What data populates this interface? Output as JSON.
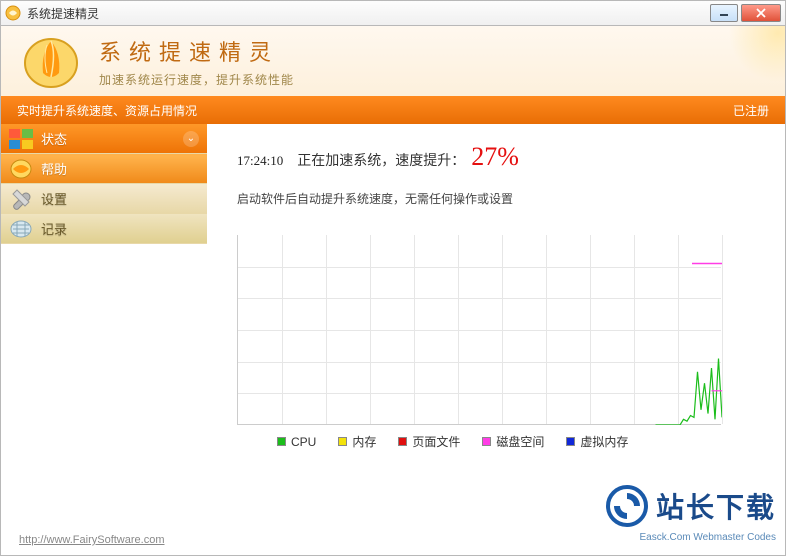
{
  "window": {
    "title": "系统提速精灵"
  },
  "brand": {
    "title": "系统提速精灵",
    "subtitle": "加速系统运行速度，提升系统性能"
  },
  "statusbar": {
    "left": "实时提升系统速度、资源占用情况",
    "right": "已注册"
  },
  "sidebar": {
    "items": [
      {
        "label": "状态",
        "icon": "windows"
      },
      {
        "label": "帮助",
        "icon": "help"
      },
      {
        "label": "设置",
        "icon": "wrench"
      },
      {
        "label": "记录",
        "icon": "log"
      }
    ]
  },
  "main": {
    "time": "17:24:10",
    "msg": "正在加速系统，速度提升：",
    "boost": "27%",
    "sub": "启动软件后自动提升系统速度，无需任何操作或设置"
  },
  "chart_data": {
    "type": "line",
    "xlabel": "",
    "ylabel": "",
    "xlim": [
      0,
      100
    ],
    "ylim": [
      0,
      100
    ],
    "grid_rows": 6,
    "grid_cols": 11,
    "series": [
      {
        "name": "CPU",
        "color": "#1bbd1b",
        "values": [
          0,
          0,
          0,
          0,
          0,
          0,
          0,
          0,
          3,
          2,
          5,
          4,
          28,
          8,
          22,
          6,
          30,
          3,
          35,
          4
        ]
      },
      {
        "name": "内存",
        "color": "#f3e20a",
        "values": []
      },
      {
        "name": "页面文件",
        "color": "#e01010",
        "values": []
      },
      {
        "name": "磁盘空间",
        "color": "#ff3de6",
        "values": [
          18,
          18,
          18,
          18
        ]
      },
      {
        "name": "虚拟内存",
        "color": "#1028d8",
        "values": []
      }
    ],
    "legend_labels": [
      "CPU",
      "内存",
      "页面文件",
      "磁盘空间",
      "虚拟内存"
    ]
  },
  "footer": {
    "url": "http://www.FairySoftware.com"
  },
  "watermark": {
    "text": "站长下载",
    "sub": "Easck.Com Webmaster Codes"
  }
}
